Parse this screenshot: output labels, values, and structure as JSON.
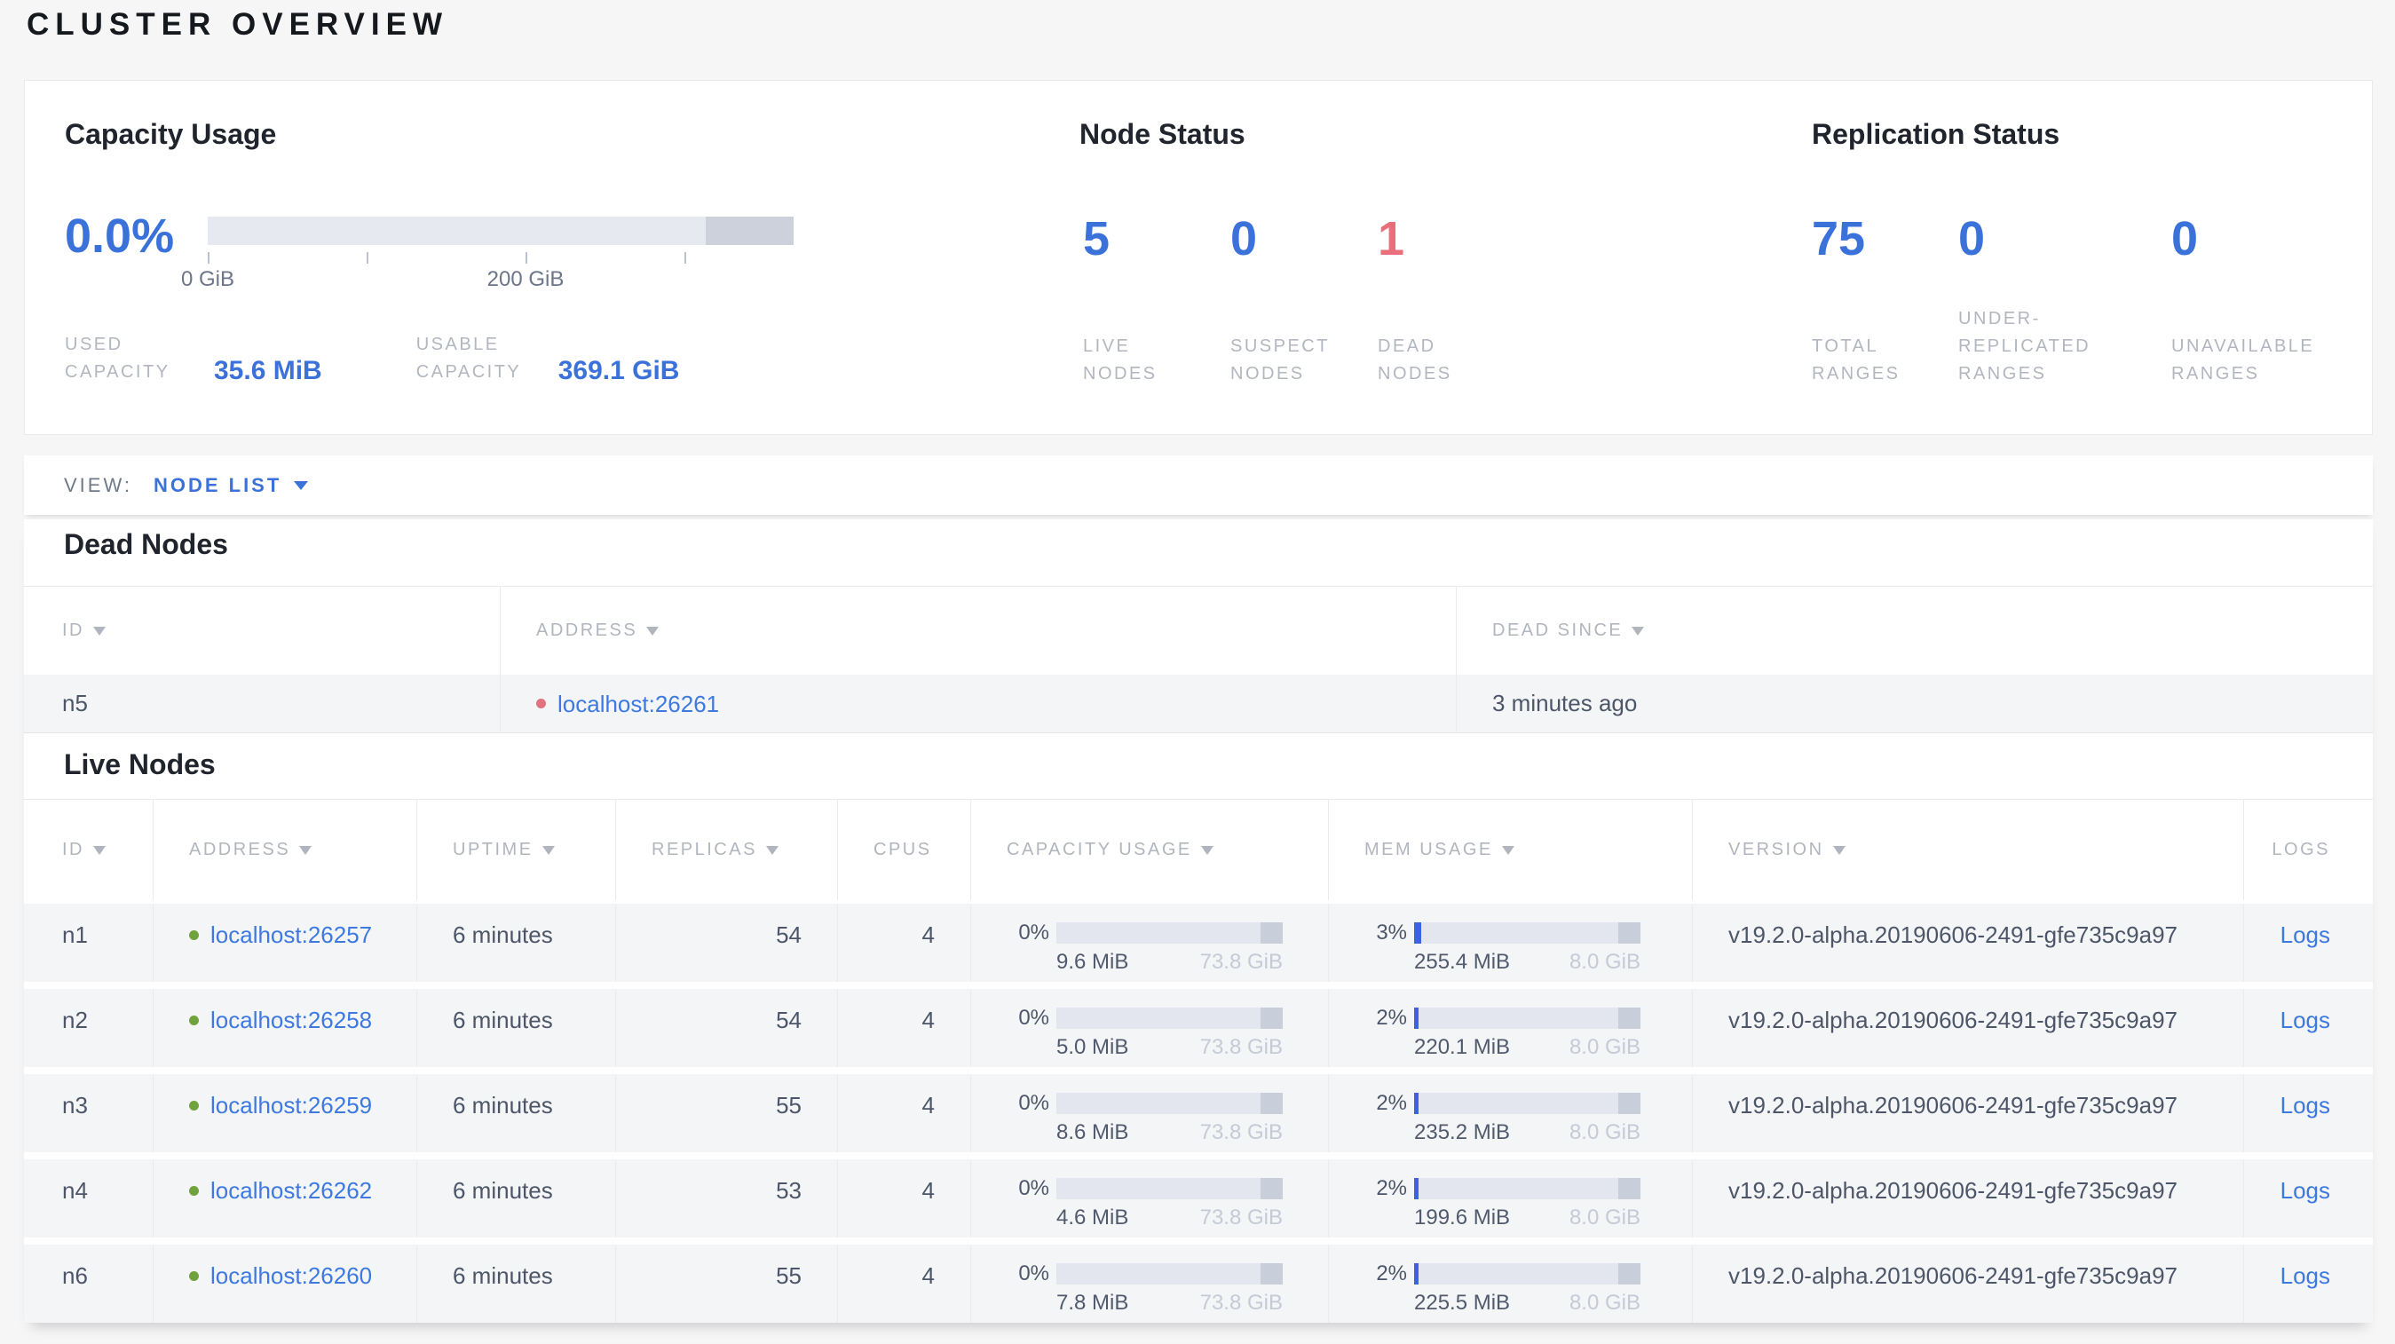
{
  "page_title": "CLUSTER OVERVIEW",
  "colors": {
    "accent_blue": "#3a72da",
    "dead_red": "#e9707b",
    "live_green": "#71a33c"
  },
  "summary": {
    "capacity": {
      "title": "Capacity Usage",
      "percent": "0.0%",
      "tick_labels": {
        "zero": "0 GiB",
        "twohundred": "200 GiB"
      },
      "stats": [
        {
          "label": "USED CAPACITY",
          "value": "35.6 MiB"
        },
        {
          "label": "USABLE CAPACITY",
          "value": "369.1 GiB"
        }
      ]
    },
    "node_status": {
      "title": "Node Status",
      "stats": [
        {
          "value": "5",
          "label": "LIVE NODES",
          "status": "live"
        },
        {
          "value": "0",
          "label": "SUSPECT NODES",
          "status": "suspect"
        },
        {
          "value": "1",
          "label": "DEAD NODES",
          "status": "dead"
        }
      ]
    },
    "replication": {
      "title": "Replication Status",
      "stats": [
        {
          "value": "75",
          "label": "TOTAL RANGES"
        },
        {
          "value": "0",
          "label": "UNDER-REPLICATED RANGES"
        },
        {
          "value": "0",
          "label": "UNAVAILABLE RANGES"
        }
      ]
    }
  },
  "view_bar": {
    "label": "VIEW:",
    "selected": "NODE LIST"
  },
  "dead_nodes": {
    "title": "Dead Nodes",
    "columns": [
      {
        "label": "ID",
        "sortable": true
      },
      {
        "label": "ADDRESS",
        "sortable": true
      },
      {
        "label": "DEAD SINCE",
        "sortable": true
      }
    ],
    "rows": [
      {
        "id": "n5",
        "address": "localhost:26261",
        "dead_since": "3 minutes ago"
      }
    ]
  },
  "live_nodes": {
    "title": "Live Nodes",
    "logs_label": "Logs",
    "columns": [
      {
        "label": "ID",
        "sortable": true
      },
      {
        "label": "ADDRESS",
        "sortable": true
      },
      {
        "label": "UPTIME",
        "sortable": true
      },
      {
        "label": "REPLICAS",
        "sortable": true
      },
      {
        "label": "CPUS",
        "sortable": false
      },
      {
        "label": "CAPACITY USAGE",
        "sortable": true
      },
      {
        "label": "MEM USAGE",
        "sortable": true
      },
      {
        "label": "VERSION",
        "sortable": true
      },
      {
        "label": "LOGS",
        "sortable": false
      }
    ],
    "rows": [
      {
        "id": "n1",
        "address": "localhost:26257",
        "uptime": "6 minutes",
        "replicas": "54",
        "cpus": "4",
        "capacity": {
          "percent": "0%",
          "pct": 0,
          "used": "9.6 MiB",
          "total": "73.8 GiB"
        },
        "mem": {
          "percent": "3%",
          "pct": 3,
          "used": "255.4 MiB",
          "total": "8.0 GiB"
        },
        "version": "v19.2.0-alpha.20190606-2491-gfe735c9a97"
      },
      {
        "id": "n2",
        "address": "localhost:26258",
        "uptime": "6 minutes",
        "replicas": "54",
        "cpus": "4",
        "capacity": {
          "percent": "0%",
          "pct": 0,
          "used": "5.0 MiB",
          "total": "73.8 GiB"
        },
        "mem": {
          "percent": "2%",
          "pct": 2,
          "used": "220.1 MiB",
          "total": "8.0 GiB"
        },
        "version": "v19.2.0-alpha.20190606-2491-gfe735c9a97"
      },
      {
        "id": "n3",
        "address": "localhost:26259",
        "uptime": "6 minutes",
        "replicas": "55",
        "cpus": "4",
        "capacity": {
          "percent": "0%",
          "pct": 0,
          "used": "8.6 MiB",
          "total": "73.8 GiB"
        },
        "mem": {
          "percent": "2%",
          "pct": 2,
          "used": "235.2 MiB",
          "total": "8.0 GiB"
        },
        "version": "v19.2.0-alpha.20190606-2491-gfe735c9a97"
      },
      {
        "id": "n4",
        "address": "localhost:26262",
        "uptime": "6 minutes",
        "replicas": "53",
        "cpus": "4",
        "capacity": {
          "percent": "0%",
          "pct": 0,
          "used": "4.6 MiB",
          "total": "73.8 GiB"
        },
        "mem": {
          "percent": "2%",
          "pct": 2,
          "used": "199.6 MiB",
          "total": "8.0 GiB"
        },
        "version": "v19.2.0-alpha.20190606-2491-gfe735c9a97"
      },
      {
        "id": "n6",
        "address": "localhost:26260",
        "uptime": "6 minutes",
        "replicas": "55",
        "cpus": "4",
        "capacity": {
          "percent": "0%",
          "pct": 0,
          "used": "7.8 MiB",
          "total": "73.8 GiB"
        },
        "mem": {
          "percent": "2%",
          "pct": 2,
          "used": "225.5 MiB",
          "total": "8.0 GiB"
        },
        "version": "v19.2.0-alpha.20190606-2491-gfe735c9a97"
      }
    ]
  }
}
